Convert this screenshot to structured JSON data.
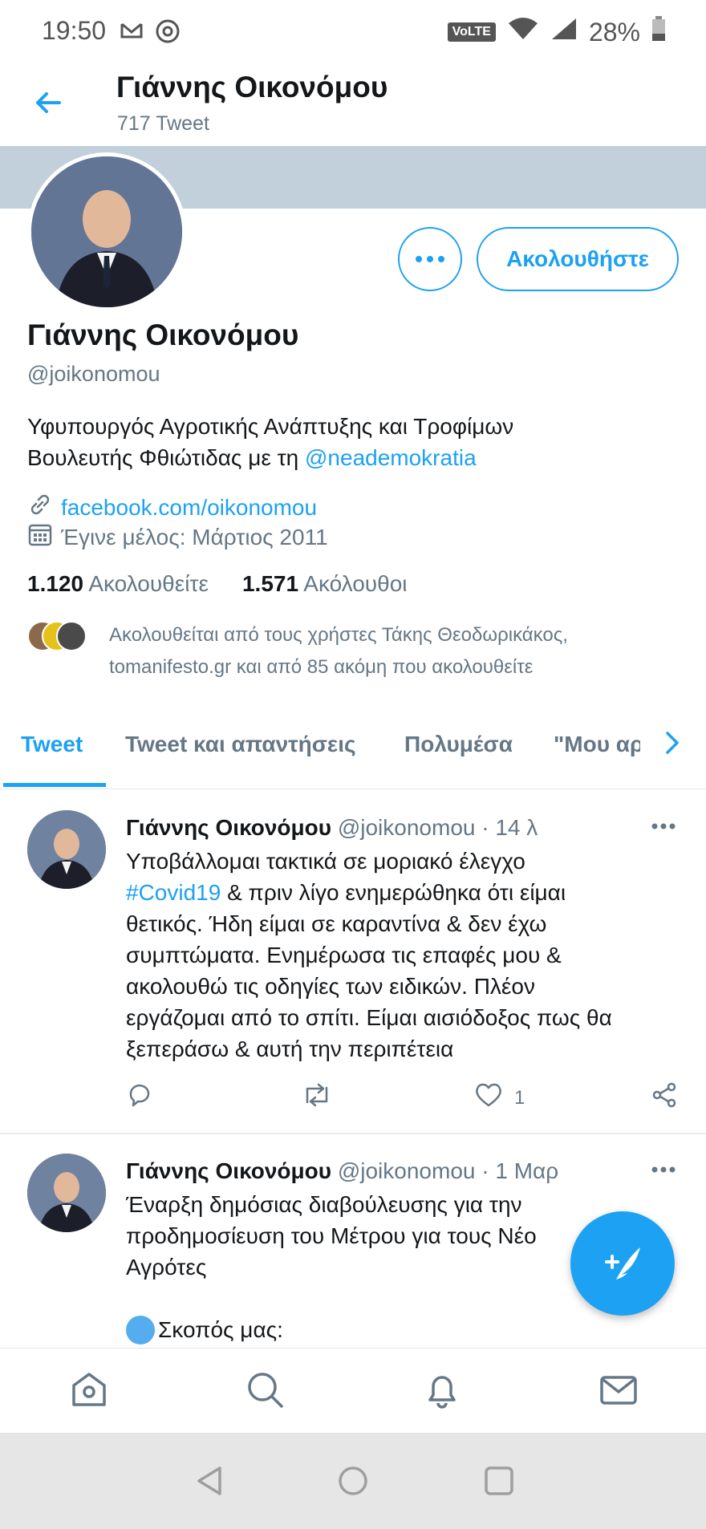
{
  "status_bar": {
    "time": "19:50",
    "volte": "VoLTE",
    "battery": "28%"
  },
  "header": {
    "name": "Γιάννης Οικονόμου",
    "tweet_count": "717 Tweet"
  },
  "profile": {
    "name": "Γιάννης Οικονόμου",
    "handle": "@joikonomou",
    "bio_line1": "Υφυπουργός Αγροτικής Ανάπτυξης και Τροφίμων",
    "bio_line2_prefix": "Βουλευτής Φθιώτιδας με τη ",
    "bio_mention": "@neademokratia",
    "link": "facebook.com/oikonomou",
    "joined": "Έγινε μέλος: Μάρτιος 2011",
    "following_count": "1.120",
    "following_label": "Ακολουθείτε",
    "followers_count": "1.571",
    "followers_label": "Ακόλουθοι",
    "followed_by_line1": "Ακολουθείται από τους χρήστες Τάκης Θεοδωρικάκος,",
    "followed_by_line2": "tomanifesto.gr και από 85 ακόμη που ακολουθείτε",
    "follow_button": "Ακολουθήστε"
  },
  "tabs": [
    {
      "label": "Tweet"
    },
    {
      "label": "Tweet και απαντήσεις"
    },
    {
      "label": "Πολυμέσα"
    },
    {
      "label": "\"Μου αρ"
    }
  ],
  "tweets": [
    {
      "name": "Γιάννης Οικονόμου",
      "handle": "@joikonomou",
      "time": "· 14 λ",
      "line1": "Υποβάλλομαι τακτικά σε μοριακό έλεγχο",
      "hashtag": "#Covid19",
      "line2_rest": " & πριν λίγο ενημερώθηκα ότι είμαι",
      "line3": "θετικός. Ήδη είμαι σε καραντίνα & δεν έχω",
      "line4": "συμπτώματα. Ενημέρωσα τις επαφές μου &",
      "line5": "ακολουθώ τις οδηγίες των ειδικών. Πλέον",
      "line6": "εργάζομαι από το σπίτι. Είμαι αισιόδοξος πως θα",
      "line7": "ξεπεράσω & αυτή την περιπέτεια",
      "likes": "1"
    },
    {
      "name": "Γιάννης Οικονόμου",
      "handle": "@joikonomou",
      "time": "· 1 Μαρ",
      "line1": "Έναρξη δημόσιας διαβούλευσης για την",
      "line2": "προδημοσίευση του Μέτρου για τους Νέο",
      "line3": "Αγρότες",
      "line5": "Σκοπός μας:"
    }
  ],
  "colors": {
    "accent": "#1da1f2",
    "banner": "#c1d0db",
    "secondary_text": "#657786"
  },
  "icons": [
    "back-arrow-icon",
    "more-icon",
    "link-icon",
    "calendar-icon",
    "chevron-right-icon",
    "reply-icon",
    "retweet-icon",
    "like-icon",
    "share-icon",
    "compose-icon",
    "home-icon",
    "search-icon",
    "notifications-icon",
    "messages-icon"
  ]
}
